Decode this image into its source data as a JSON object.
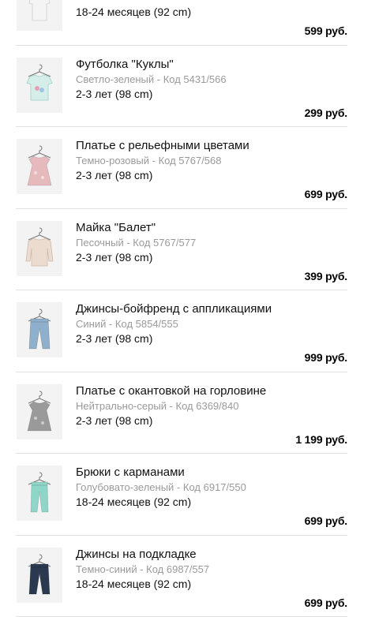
{
  "items": [
    {
      "name": "",
      "color": "",
      "code": "",
      "size": "18-24 месяцев (92 cm)",
      "price": "599 руб.",
      "thumb_icon": "white-bodysuit-icon"
    },
    {
      "name": "Футболка \"Куклы\"",
      "color": "Светло-зеленый",
      "code": "Код 5431/566",
      "size": "2-3 лет (98 cm)",
      "price": "299 руб.",
      "thumb_icon": "tshirt-icon"
    },
    {
      "name": "Платье с рельефными цветами",
      "color": "Темно-розовый",
      "code": "Код 5767/568",
      "size": "2-3 лет (98 cm)",
      "price": "699 руб.",
      "thumb_icon": "dress-icon"
    },
    {
      "name": "Майка \"Балет\"",
      "color": "Песочный",
      "code": "Код 5767/577",
      "size": "2-3 лет (98 cm)",
      "price": "399 руб.",
      "thumb_icon": "long-sleeve-top-icon"
    },
    {
      "name": "Джинсы-бойфренд с аппликациями",
      "color": "Синий",
      "code": "Код 5854/555",
      "size": "2-3 лет (98 cm)",
      "price": "999 руб.",
      "thumb_icon": "jeans-icon"
    },
    {
      "name": "Платье с окантовкой на горловине",
      "color": "Нейтрально-серый",
      "code": "Код 6369/840",
      "size": "2-3 лет (98 cm)",
      "price": "1 199 руб.",
      "thumb_icon": "dress-icon"
    },
    {
      "name": "Брюки с карманами",
      "color": "Голубовато-зеленый",
      "code": "Код 6917/550",
      "size": "18-24 месяцев (92 cm)",
      "price": "699 руб.",
      "thumb_icon": "trousers-icon"
    },
    {
      "name": "Джинсы на подкладке",
      "color": "Темно-синий",
      "code": "Код 6987/557",
      "size": "18-24 месяцев (92 cm)",
      "price": "699 руб.",
      "thumb_icon": "jeans-icon"
    }
  ],
  "meta_separator": " - ",
  "colors": {
    "text": "#111111",
    "muted": "#9a9a9a",
    "divider": "#e2e2e2",
    "thumb_bg": "#f3f3f3",
    "garments": [
      "#f4f4f4",
      "#d6eeea",
      "#e6b9bd",
      "#ecdcd0",
      "#8fb0cc",
      "#9a9a9a",
      "#8fd6c8",
      "#2a3850"
    ]
  }
}
